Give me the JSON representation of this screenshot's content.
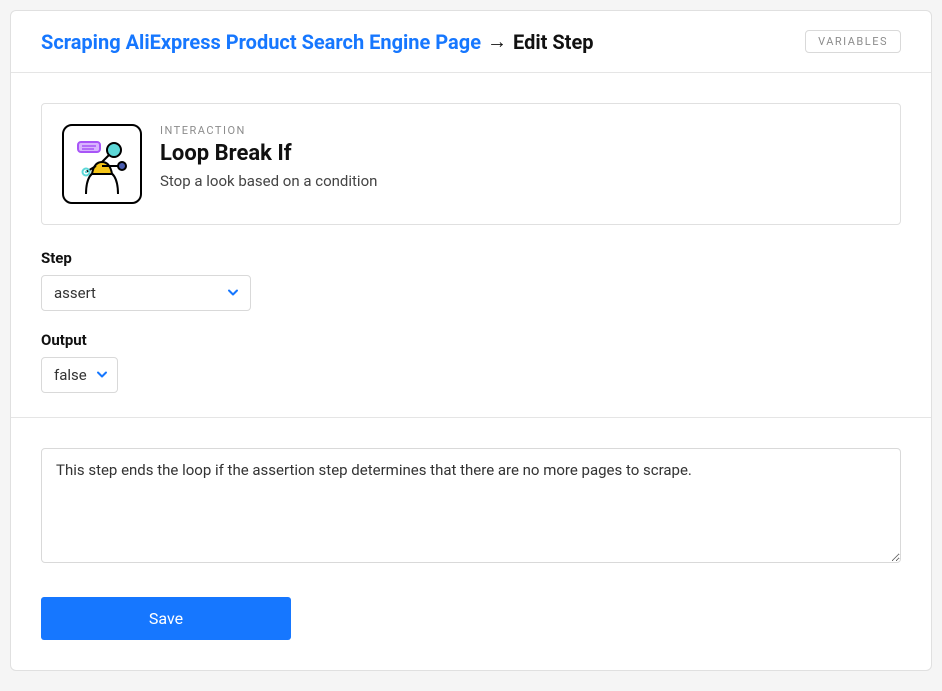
{
  "header": {
    "breadcrumb_link": "Scraping AliExpress Product Search Engine Page",
    "breadcrumb_arrow": "→",
    "breadcrumb_current": "Edit Step",
    "variables_button": "VARIABLES"
  },
  "info": {
    "category": "INTERACTION",
    "title": "Loop Break If",
    "subtitle": "Stop a look based on a condition"
  },
  "fields": {
    "step_label": "Step",
    "step_value": "assert",
    "output_label": "Output",
    "output_value": "false"
  },
  "description": {
    "value": "This step ends the loop if the assertion step determines that there are no more pages to scrape."
  },
  "actions": {
    "save": "Save"
  }
}
